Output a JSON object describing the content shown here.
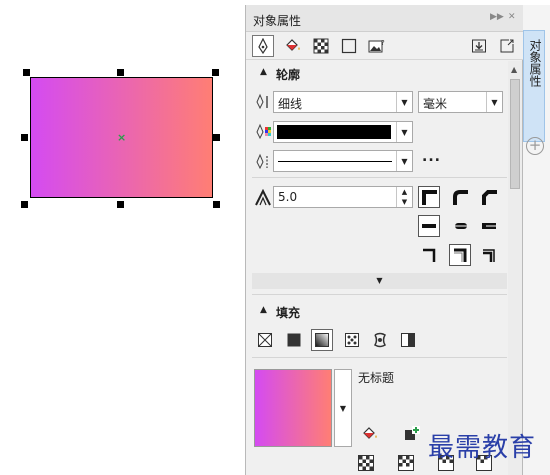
{
  "panel": {
    "title": "对象属性",
    "outline_section": "轮廓",
    "fill_section": "填充",
    "outline_width": "细线",
    "units": "毫米",
    "outline_color": "#000000",
    "miter_limit": "5.0",
    "fill_name": "无标题",
    "more_label": "..."
  },
  "side_tab": {
    "label": "对象属性",
    "add_symbol": "+"
  },
  "canvas": {
    "gradient_start": "#d44bf2",
    "gradient_end": "#ff7e74",
    "center_mark": "×"
  },
  "watermark": "最需教育"
}
